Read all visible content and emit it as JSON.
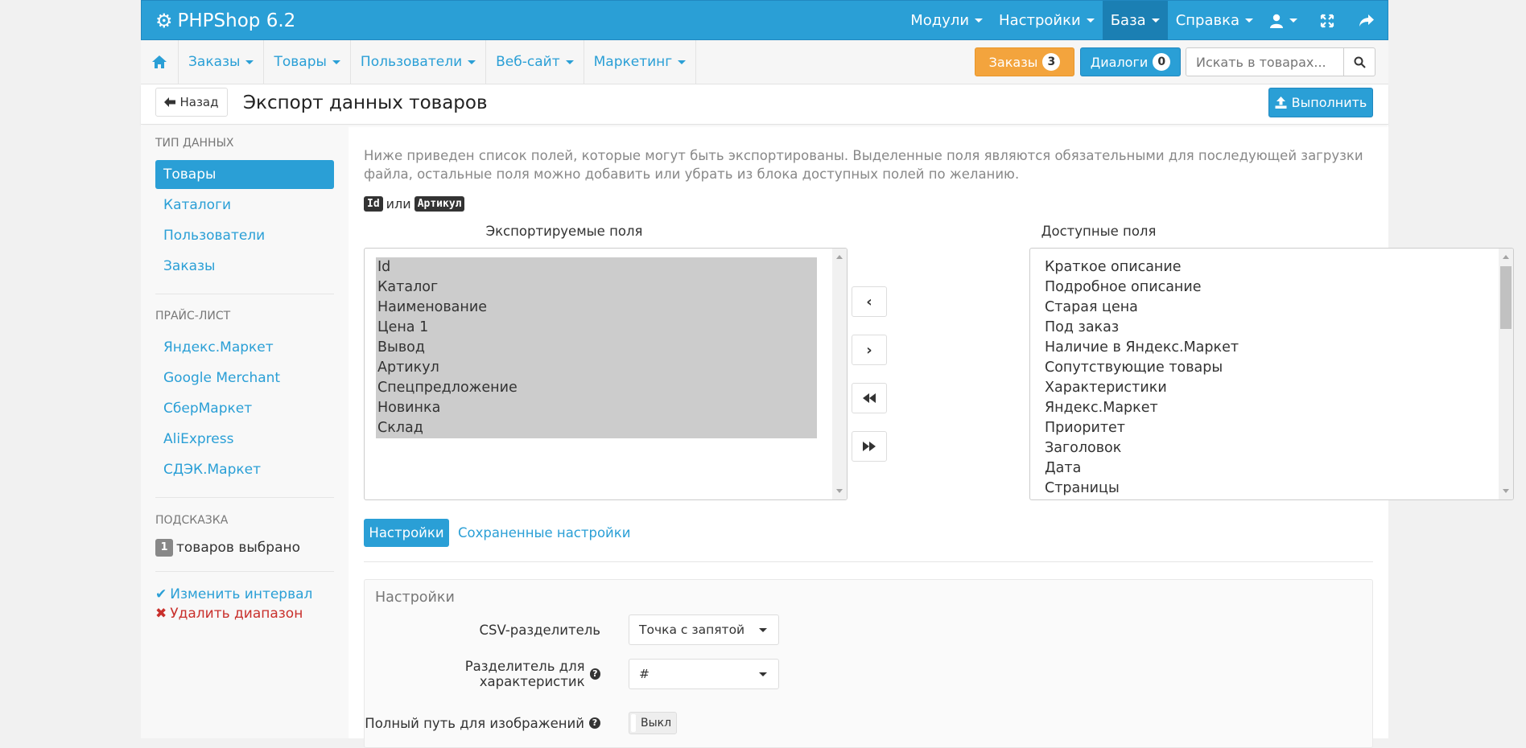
{
  "app": {
    "brand": "PHPShop 6.2"
  },
  "topnav": [
    {
      "label": "Модули"
    },
    {
      "label": "Настройки"
    },
    {
      "label": "База",
      "active": true
    },
    {
      "label": "Справка"
    }
  ],
  "subnav": [
    {
      "label": "Заказы"
    },
    {
      "label": "Товары"
    },
    {
      "label": "Пользователи"
    },
    {
      "label": "Веб-сайт"
    },
    {
      "label": "Маркетинг"
    }
  ],
  "badges": {
    "orders_label": "Заказы",
    "orders_count": "3",
    "dialogs_label": "Диалоги",
    "dialogs_count": "0"
  },
  "search": {
    "placeholder": "Искать в товарах..."
  },
  "header": {
    "back": "Назад",
    "title": "Экспорт данных товаров",
    "run": "Выполнить"
  },
  "sidebar": {
    "data_type_head": "Тип данных",
    "data_types": [
      "Товары",
      "Каталоги",
      "Пользователи",
      "Заказы"
    ],
    "price_head": "Прайс-лист",
    "price_items": [
      "Яндекс.Маркет",
      "Google Merchant",
      "СберМаркет",
      "AliExpress",
      "СДЭК.Маркет"
    ],
    "hint_head": "Подсказка",
    "hint_count": "1",
    "hint_text": "товаров выбрано",
    "change_interval": "Изменить интервал",
    "delete_range": "Удалить диапазон"
  },
  "main": {
    "description": "Ниже приведен список полей, которые могут быть экспортированы. Выделенные поля являются обязательными для последующей загрузки файла, остальные поля можно добавить или убрать из блока доступных полей по желанию.",
    "code_id": "Id",
    "code_or": "или",
    "code_article": "Артикул",
    "exported_title": "Экспортируемые поля",
    "available_title": "Доступные поля",
    "exported_fields": [
      "Id",
      "Каталог",
      "Наименование",
      "Цена 1",
      "Вывод",
      "Артикул",
      "Спецпредложение",
      "Новинка",
      "Склад"
    ],
    "available_fields": [
      "Краткое описание",
      "Подробное описание",
      "Старая цена",
      "Под заказ",
      "Наличие в Яндекс.Маркет",
      "Сопутствующие товары",
      "Характеристики",
      "Яндекс.Маркет",
      "Приоритет",
      "Заголовок",
      "Дата",
      "Страницы"
    ],
    "tab_settings": "Настройки",
    "tab_saved": "Сохраненные настройки"
  },
  "settings": {
    "title": "Настройки",
    "csv_label": "CSV-разделитель",
    "csv_value": "Точка с запятой",
    "char_sep_label": "Разделитель для характеристик",
    "char_sep_value": "#",
    "image_path_label": "Полный путь для изображений",
    "image_path_value": "Выкл"
  },
  "colors": {
    "accent": "#2a9fd6",
    "orders": "#f3a43d",
    "danger": "#c9302c",
    "success": "#2a9fd6"
  }
}
